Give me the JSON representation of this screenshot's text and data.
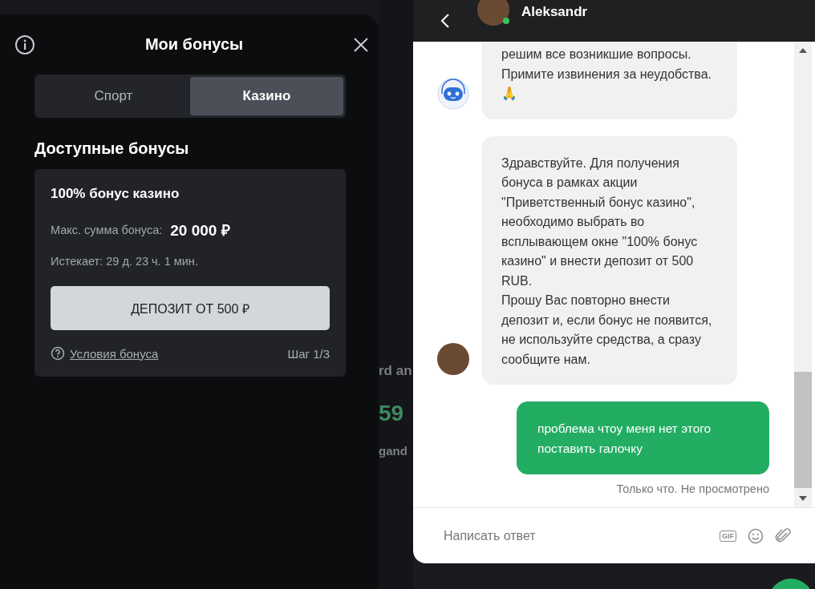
{
  "bonuses_panel": {
    "title": "Мои бонусы",
    "tabs": [
      {
        "label": "Спорт",
        "selected": false
      },
      {
        "label": "Казино",
        "selected": true
      }
    ],
    "section_title": "Доступные бонусы",
    "bonus": {
      "title": "100% бонус казино",
      "max_label": "Макс. сумма бонуса:",
      "max_value": "20 000 ₽",
      "expires": "Истекает: 29 д. 23 ч. 1 мин.",
      "button": "ДЕПОЗИТ ОТ 500 ₽",
      "terms_link": "Условия бонуса",
      "step": "Шаг 1/3"
    }
  },
  "background_fragments": [
    "rd an",
    "59",
    "gand"
  ],
  "chat": {
    "agent_name": "Aleksandr",
    "agent_online": true,
    "messages": [
      {
        "kind": "bot",
        "text": "решим все возникшие вопросы. Примите извинения за неудобства. 🙏"
      },
      {
        "kind": "agent",
        "text": "Здравствуйте. Для получения бонуса в рамках акции \"Приветственный бонус казино\", необходимо выбрать во всплывающем окне \"100% бонус казино\" и внести депозит от 500 RUB.\nПрошу Вас повторно внести депозит и, если бонус не появится, не используйте средства, а сразу сообщите нам."
      },
      {
        "kind": "outgoing",
        "text": "проблема чтоу меня нет этого поставить галочку",
        "status": "Только что. Не просмотрено"
      }
    ],
    "composer": {
      "placeholder": "Написать ответ",
      "gif_label": "GIF"
    }
  }
}
